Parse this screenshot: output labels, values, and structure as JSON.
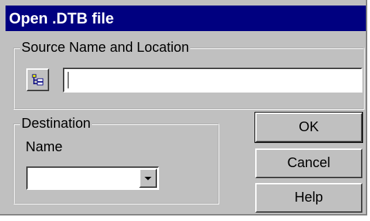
{
  "dialog": {
    "title": "Open .DTB file"
  },
  "source": {
    "group_label": "Source Name and Location",
    "path_value": "",
    "browse_icon": "tree-browse-icon"
  },
  "destination": {
    "group_label": "Destination",
    "name_label": "Name",
    "selected_value": ""
  },
  "buttons": {
    "ok_label": "OK",
    "cancel_label": "Cancel",
    "help_label": "Help"
  },
  "colors": {
    "title_bar": "#000080",
    "face": "#c0c0c0",
    "field": "#ffffff"
  }
}
